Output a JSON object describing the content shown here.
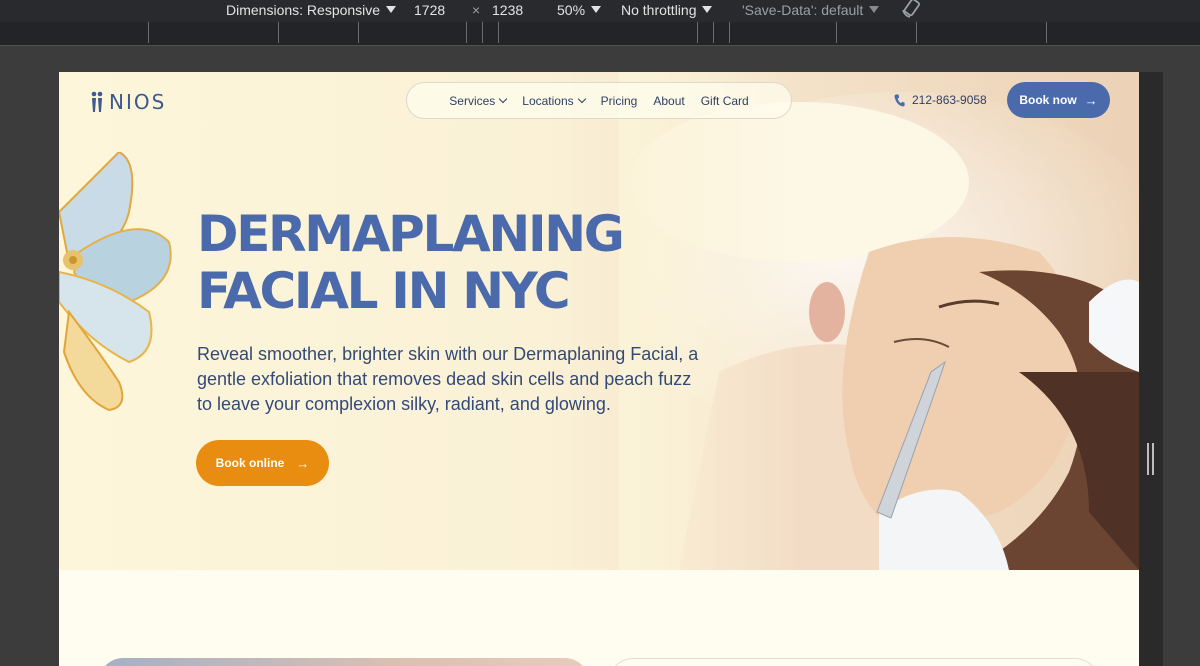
{
  "devtools": {
    "dimensions_label": "Dimensions: Responsive",
    "width": "1728",
    "times": "×",
    "height": "1238",
    "zoom": "50%",
    "throttling": "No throttling",
    "save_data": "'Save-Data': default"
  },
  "site": {
    "logo_text": "NIOS",
    "nav": {
      "services": "Services",
      "locations": "Locations",
      "pricing": "Pricing",
      "about": "About",
      "gift_card": "Gift Card"
    },
    "phone": "212-863-9058",
    "book_now": "Book now",
    "hero": {
      "title_line1": "DERMAPLANING",
      "title_line2": "FACIAL IN NYC",
      "description": "Reveal smoother, brighter skin with our Dermaplaning Facial, a gentle exfoliation that removes dead skin cells and peach fuzz to leave your complexion silky, radiant, and glowing.",
      "cta": "Book online"
    },
    "colors": {
      "brand_blue": "#4a6aac",
      "cta_orange": "#e88d0f",
      "page_bg": "#fffdf0"
    }
  },
  "icons": [
    "dropdown-triangle-icon",
    "device-rotate-icon",
    "chevron-down-icon",
    "phone-icon",
    "arrow-right-icon",
    "logo-figure-icon"
  ]
}
